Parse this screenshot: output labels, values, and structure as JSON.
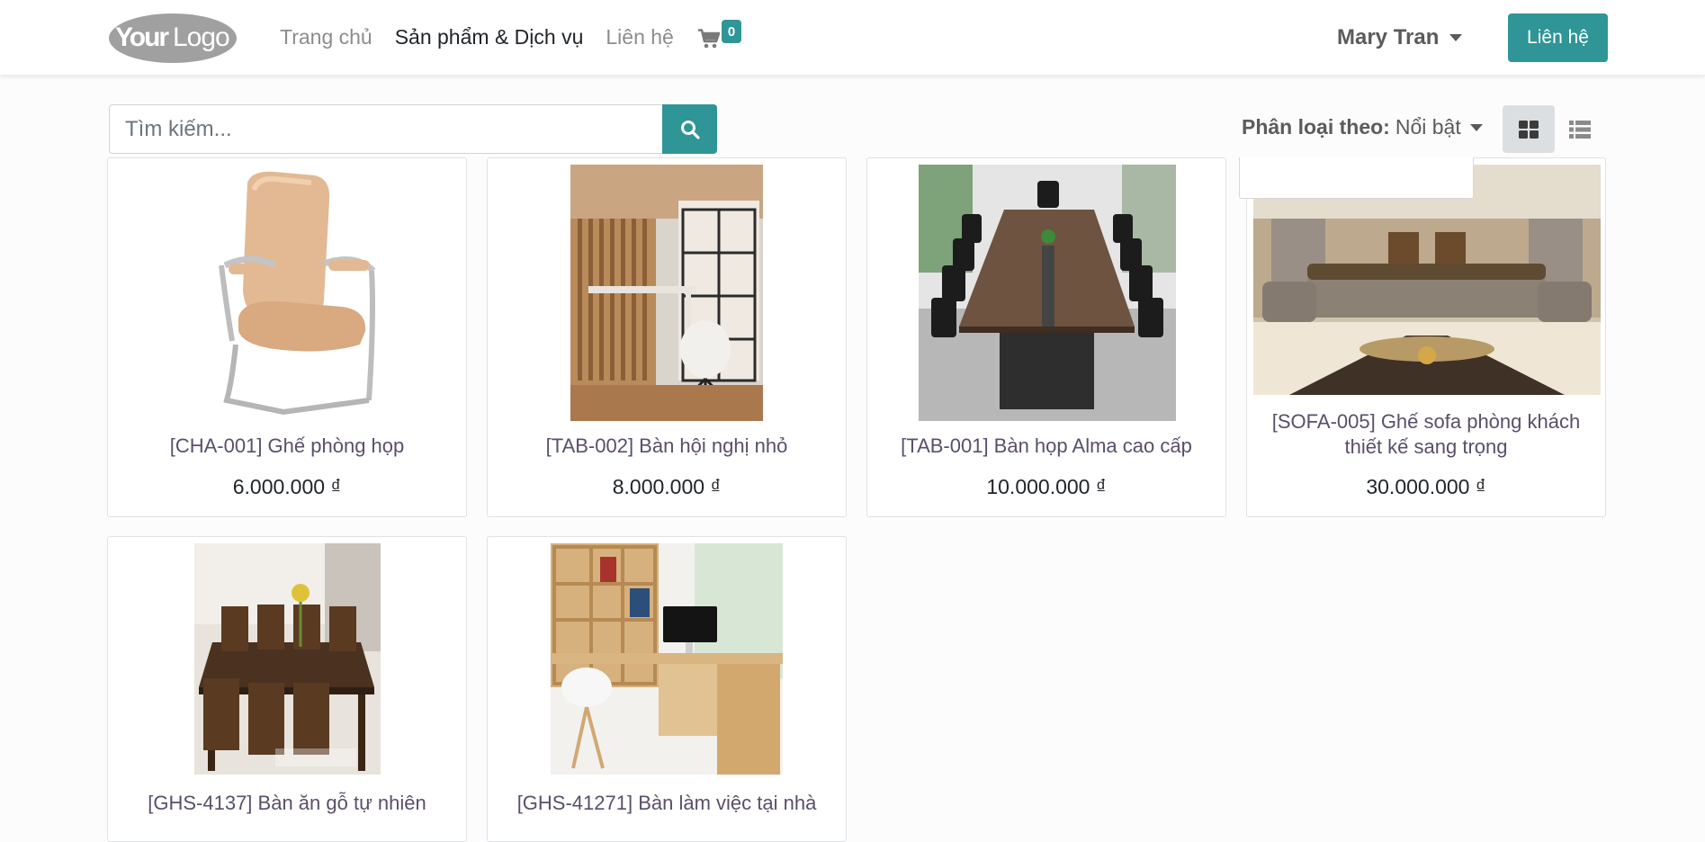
{
  "header": {
    "logo_text": "YourLogo",
    "nav": [
      {
        "label": "Trang chủ",
        "active": false
      },
      {
        "label": "Sản phẩm & Dịch vụ",
        "active": true
      },
      {
        "label": "Liên hệ",
        "active": false
      }
    ],
    "cart_count": "0",
    "user_name": "Mary Tran",
    "contact_button": "Liên hệ"
  },
  "toolbar": {
    "search_placeholder": "Tìm kiếm...",
    "sort_label": "Phân loại theo:",
    "sort_value": "Nổi bật",
    "view_active": "grid"
  },
  "products": [
    {
      "title": "[CHA-001] Ghế phòng họp",
      "price": "6.000.000 ₫",
      "image": "office-chair-image"
    },
    {
      "title": "[TAB-002] Bàn hội nghị nhỏ",
      "price": "8.000.000 ₫",
      "image": "study-room-image"
    },
    {
      "title": "[TAB-001] Bàn họp Alma cao cấp",
      "price": "10.000.000 ₫",
      "image": "conference-table-image"
    },
    {
      "title": "[SOFA-005] Ghế sofa phòng khách thiết kế sang trọng",
      "price": "30.000.000 ₫",
      "image": "living-room-sofa-image"
    },
    {
      "title": "[GHS-4137] Bàn ăn gỗ tự nhiên",
      "price": "",
      "image": "dining-table-image"
    },
    {
      "title": "[GHS-41271] Bàn làm việc tại nhà",
      "price": "",
      "image": "home-desk-image"
    }
  ],
  "colors": {
    "accent": "#2f9596",
    "product_title": "#5a4f6b",
    "nav_inactive": "#8c8c8c"
  }
}
